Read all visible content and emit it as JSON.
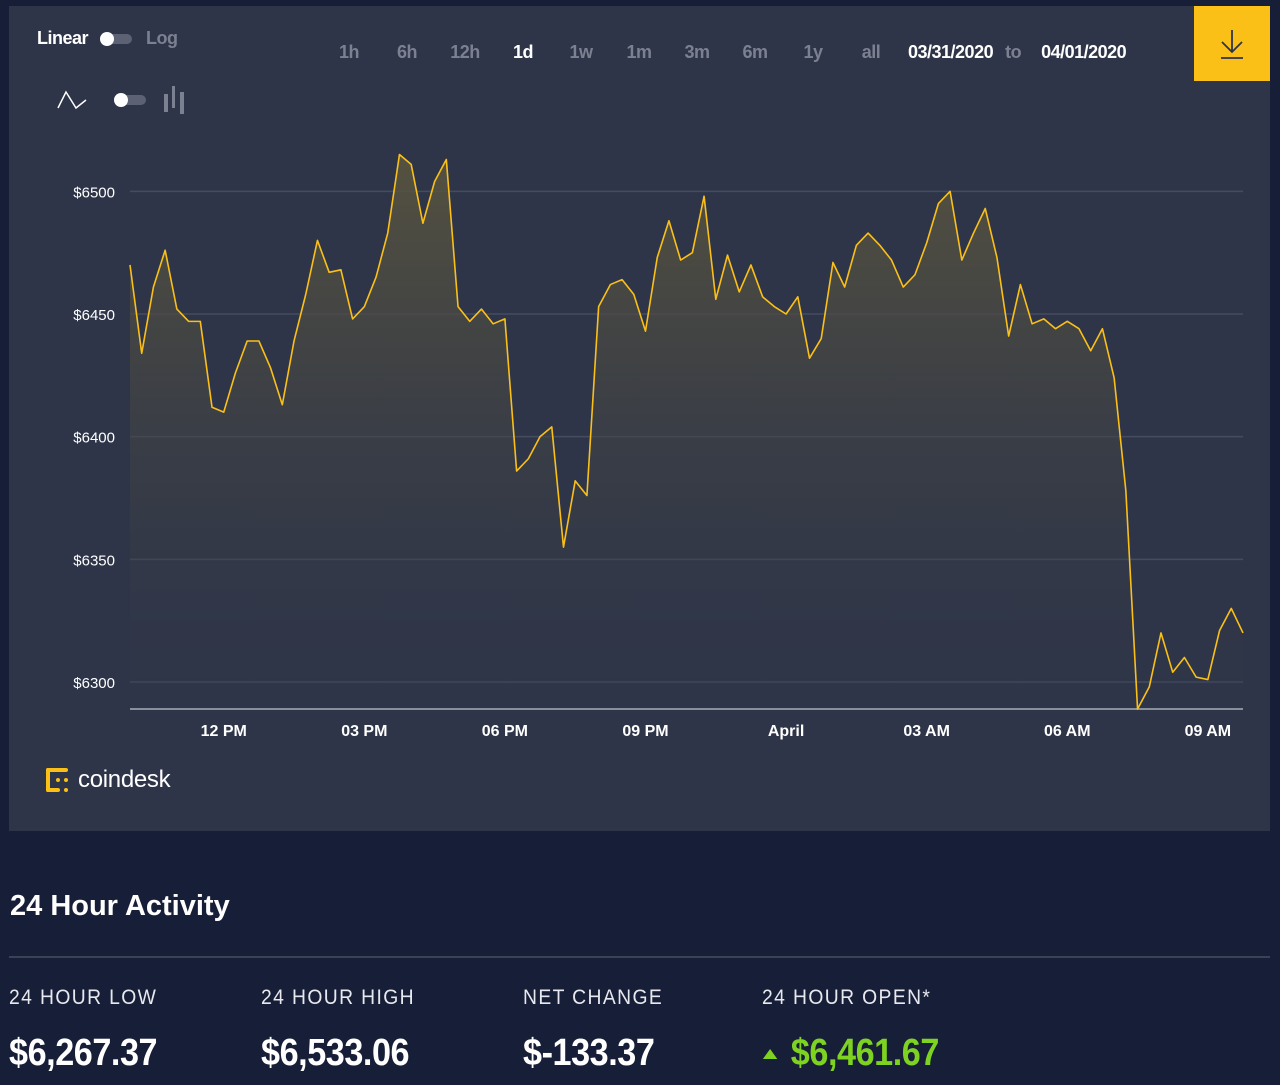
{
  "controls": {
    "scale_linear": "Linear",
    "scale_log": "Log",
    "scale_selected": "Linear",
    "chart_type_selected": "line",
    "ranges": [
      "1h",
      "6h",
      "12h",
      "1d",
      "1w",
      "1m",
      "3m",
      "6m",
      "1y",
      "all"
    ],
    "active_range": "1d",
    "date_from": "03/31/2020",
    "date_to_label": "to",
    "date_to": "04/01/2020",
    "download_icon": "download-icon"
  },
  "colors": {
    "accent": "#fbc018",
    "panel": "#2e3548",
    "page": "#171e38",
    "line": "#fbc018",
    "positive": "#7ed321"
  },
  "logo": {
    "text": "coindesk"
  },
  "chart_data": {
    "type": "area",
    "ylim": [
      6289,
      6525
    ],
    "xlim": [
      "2020-03-31T10:00",
      "2020-04-01T09:45"
    ],
    "y_ticks": [
      6300,
      6350,
      6400,
      6450,
      6500
    ],
    "y_tick_labels": [
      "$6300",
      "$6350",
      "$6400",
      "$6450",
      "$6500"
    ],
    "x_ticks": [
      "2020-03-31T12:00",
      "2020-03-31T15:00",
      "2020-03-31T18:00",
      "2020-03-31T21:00",
      "2020-04-01T00:00",
      "2020-04-01T03:00",
      "2020-04-01T06:00",
      "2020-04-01T09:00"
    ],
    "x_tick_labels": [
      "12 PM",
      "03 PM",
      "06 PM",
      "09 PM",
      "April",
      "03 AM",
      "06 AM",
      "09 AM"
    ],
    "grid": true,
    "points": [
      [
        "2020-03-31T10:00",
        6470
      ],
      [
        "2020-03-31T10:15",
        6434
      ],
      [
        "2020-03-31T10:30",
        6461
      ],
      [
        "2020-03-31T10:45",
        6476
      ],
      [
        "2020-03-31T11:00",
        6452
      ],
      [
        "2020-03-31T11:15",
        6447
      ],
      [
        "2020-03-31T11:30",
        6447
      ],
      [
        "2020-03-31T11:45",
        6412
      ],
      [
        "2020-03-31T12:00",
        6410
      ],
      [
        "2020-03-31T12:15",
        6426
      ],
      [
        "2020-03-31T12:30",
        6439
      ],
      [
        "2020-03-31T12:45",
        6439
      ],
      [
        "2020-03-31T13:00",
        6428
      ],
      [
        "2020-03-31T13:15",
        6413
      ],
      [
        "2020-03-31T13:30",
        6439
      ],
      [
        "2020-03-31T13:45",
        6458
      ],
      [
        "2020-03-31T14:00",
        6480
      ],
      [
        "2020-03-31T14:15",
        6467
      ],
      [
        "2020-03-31T14:30",
        6468
      ],
      [
        "2020-03-31T14:45",
        6448
      ],
      [
        "2020-03-31T15:00",
        6453
      ],
      [
        "2020-03-31T15:15",
        6465
      ],
      [
        "2020-03-31T15:30",
        6483
      ],
      [
        "2020-03-31T15:45",
        6515
      ],
      [
        "2020-03-31T16:00",
        6511
      ],
      [
        "2020-03-31T16:15",
        6487
      ],
      [
        "2020-03-31T16:30",
        6504
      ],
      [
        "2020-03-31T16:45",
        6513
      ],
      [
        "2020-03-31T17:00",
        6453
      ],
      [
        "2020-03-31T17:15",
        6447
      ],
      [
        "2020-03-31T17:30",
        6452
      ],
      [
        "2020-03-31T17:45",
        6446
      ],
      [
        "2020-03-31T18:00",
        6448
      ],
      [
        "2020-03-31T18:15",
        6386
      ],
      [
        "2020-03-31T18:30",
        6391
      ],
      [
        "2020-03-31T18:45",
        6400
      ],
      [
        "2020-03-31T19:00",
        6404
      ],
      [
        "2020-03-31T19:15",
        6355
      ],
      [
        "2020-03-31T19:30",
        6382
      ],
      [
        "2020-03-31T19:45",
        6376
      ],
      [
        "2020-03-31T20:00",
        6453
      ],
      [
        "2020-03-31T20:15",
        6462
      ],
      [
        "2020-03-31T20:30",
        6464
      ],
      [
        "2020-03-31T20:45",
        6458
      ],
      [
        "2020-03-31T21:00",
        6443
      ],
      [
        "2020-03-31T21:15",
        6473
      ],
      [
        "2020-03-31T21:30",
        6488
      ],
      [
        "2020-03-31T21:45",
        6472
      ],
      [
        "2020-03-31T22:00",
        6475
      ],
      [
        "2020-03-31T22:15",
        6498
      ],
      [
        "2020-03-31T22:30",
        6456
      ],
      [
        "2020-03-31T22:45",
        6474
      ],
      [
        "2020-03-31T23:00",
        6459
      ],
      [
        "2020-03-31T23:15",
        6470
      ],
      [
        "2020-03-31T23:30",
        6457
      ],
      [
        "2020-03-31T23:45",
        6453
      ],
      [
        "2020-04-01T00:00",
        6450
      ],
      [
        "2020-04-01T00:15",
        6457
      ],
      [
        "2020-04-01T00:30",
        6432
      ],
      [
        "2020-04-01T00:45",
        6440
      ],
      [
        "2020-04-01T01:00",
        6471
      ],
      [
        "2020-04-01T01:15",
        6461
      ],
      [
        "2020-04-01T01:30",
        6478
      ],
      [
        "2020-04-01T01:45",
        6483
      ],
      [
        "2020-04-01T02:00",
        6478
      ],
      [
        "2020-04-01T02:15",
        6472
      ],
      [
        "2020-04-01T02:30",
        6461
      ],
      [
        "2020-04-01T02:45",
        6466
      ],
      [
        "2020-04-01T03:00",
        6479
      ],
      [
        "2020-04-01T03:15",
        6495
      ],
      [
        "2020-04-01T03:30",
        6500
      ],
      [
        "2020-04-01T03:45",
        6472
      ],
      [
        "2020-04-01T04:00",
        6483
      ],
      [
        "2020-04-01T04:15",
        6493
      ],
      [
        "2020-04-01T04:30",
        6473
      ],
      [
        "2020-04-01T04:45",
        6441
      ],
      [
        "2020-04-01T05:00",
        6462
      ],
      [
        "2020-04-01T05:15",
        6446
      ],
      [
        "2020-04-01T05:30",
        6448
      ],
      [
        "2020-04-01T05:45",
        6444
      ],
      [
        "2020-04-01T06:00",
        6447
      ],
      [
        "2020-04-01T06:15",
        6444
      ],
      [
        "2020-04-01T06:30",
        6435
      ],
      [
        "2020-04-01T06:45",
        6444
      ],
      [
        "2020-04-01T07:00",
        6424
      ],
      [
        "2020-04-01T07:15",
        6378
      ],
      [
        "2020-04-01T07:30",
        6289
      ],
      [
        "2020-04-01T07:45",
        6298
      ],
      [
        "2020-04-01T08:00",
        6320
      ],
      [
        "2020-04-01T08:15",
        6304
      ],
      [
        "2020-04-01T08:30",
        6310
      ],
      [
        "2020-04-01T08:45",
        6302
      ],
      [
        "2020-04-01T09:00",
        6301
      ],
      [
        "2020-04-01T09:15",
        6321
      ],
      [
        "2020-04-01T09:30",
        6330
      ],
      [
        "2020-04-01T09:45",
        6320
      ]
    ]
  },
  "activity": {
    "title": "24 Hour Activity",
    "stats": [
      {
        "label": "24 HOUR LOW",
        "value": "$6,267.37"
      },
      {
        "label": "24 HOUR HIGH",
        "value": "$6,533.06"
      },
      {
        "label": "NET CHANGE",
        "value": "$-133.37"
      },
      {
        "label": "24 HOUR OPEN*",
        "value": "$6,461.67",
        "trend": "up"
      }
    ]
  }
}
